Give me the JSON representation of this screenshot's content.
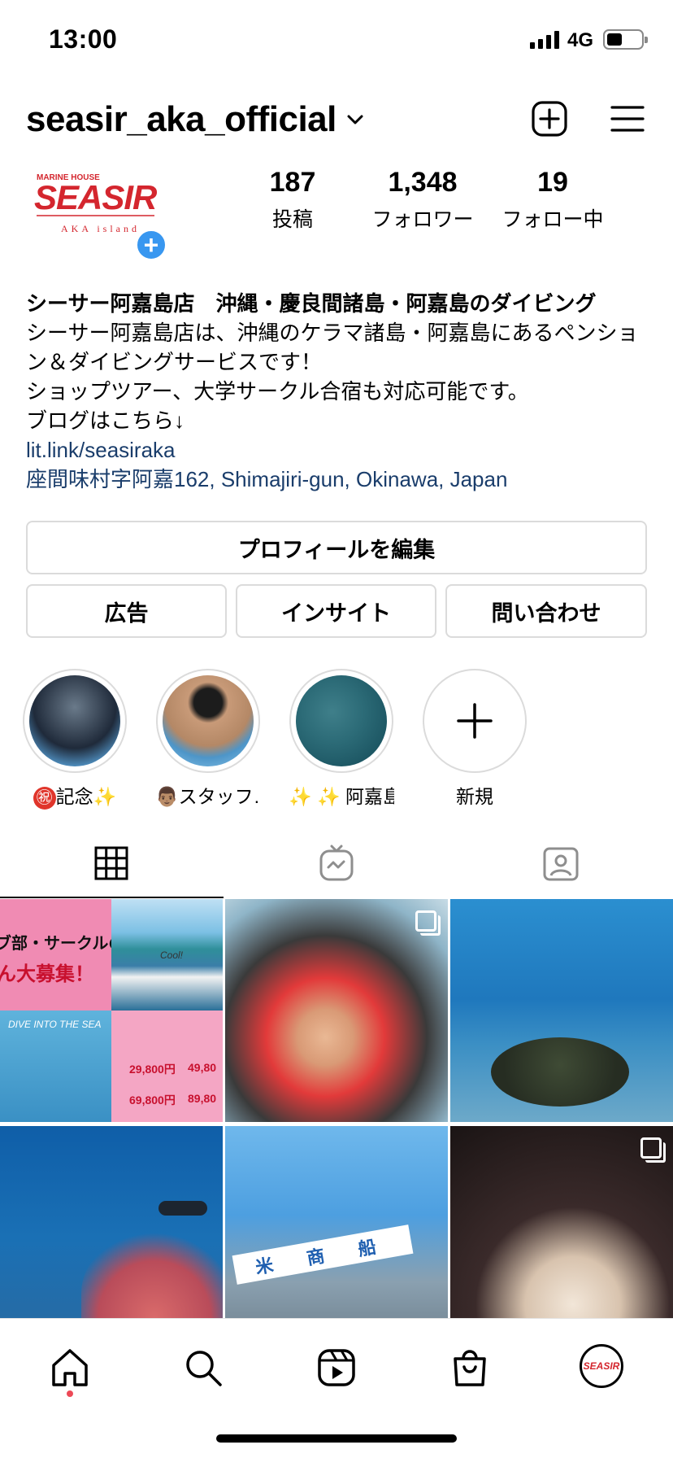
{
  "status_bar": {
    "time": "13:00",
    "network": "4G",
    "battery_percent": 45
  },
  "header": {
    "username": "seasir_aka_official",
    "icons": [
      "chevron-down-icon",
      "new-post-icon",
      "menu-icon"
    ]
  },
  "profile": {
    "avatar_logo": {
      "small": "MARINE HOUSE",
      "main": "SEASIR",
      "sub": "AKA island"
    },
    "stats": [
      {
        "value": "187",
        "label": "投稿"
      },
      {
        "value": "1,348",
        "label": "フォロワー"
      },
      {
        "value": "19",
        "label": "フォロー中"
      }
    ]
  },
  "bio": {
    "name": "シーサー阿嘉島店　沖縄・慶良間諸島・阿嘉島のダイビング",
    "lines": [
      "シーサー阿嘉島店は、沖縄のケラマ諸島・阿嘉島にあるペンショ",
      "ン＆ダイビングサービスです！",
      "ショップツアー、大学サークル合宿も対応可能です。",
      "ブログはこちら↓"
    ],
    "link": "lit.link/seasiraka",
    "address": "座間味村字阿嘉162, Shimajiri-gun, Okinawa, Japan"
  },
  "buttons": {
    "edit_profile": "プロフィールを編集",
    "ads": "広告",
    "insights": "インサイト",
    "contact": "問い合わせ"
  },
  "highlights": [
    {
      "emoji": "㊗",
      "label": "記念✨"
    },
    {
      "emoji": "👨🏽",
      "label": "スタッフ…"
    },
    {
      "emoji": "",
      "label": "✨ ✨ 阿嘉島…"
    },
    {
      "emoji": "",
      "label": "新規"
    }
  ],
  "tabs": [
    "grid-icon",
    "igtv-icon",
    "tagged-icon"
  ],
  "grid_posts": [
    {
      "text_lines": [
        "ブ部・サークルの",
        "ん大募集！"
      ],
      "small": "DIVE INTO THE SEA",
      "prices": [
        "29,800円",
        "49,80",
        "69,800円",
        "89,80"
      ],
      "badge": "Cool!"
    },
    {
      "multiple": true
    },
    {
      "multiple": false
    },
    {
      "multiple": false
    },
    {
      "banner": "米 商 船"
    },
    {
      "multiple": true
    }
  ],
  "colors": {
    "brand_red": "#d4262e",
    "link_blue": "#1a3d6b",
    "accent_blue": "#3897f0",
    "notification_dot": "#ed4956"
  },
  "nav": [
    "home-icon",
    "search-icon",
    "reels-icon",
    "shop-icon",
    "profile-avatar"
  ]
}
